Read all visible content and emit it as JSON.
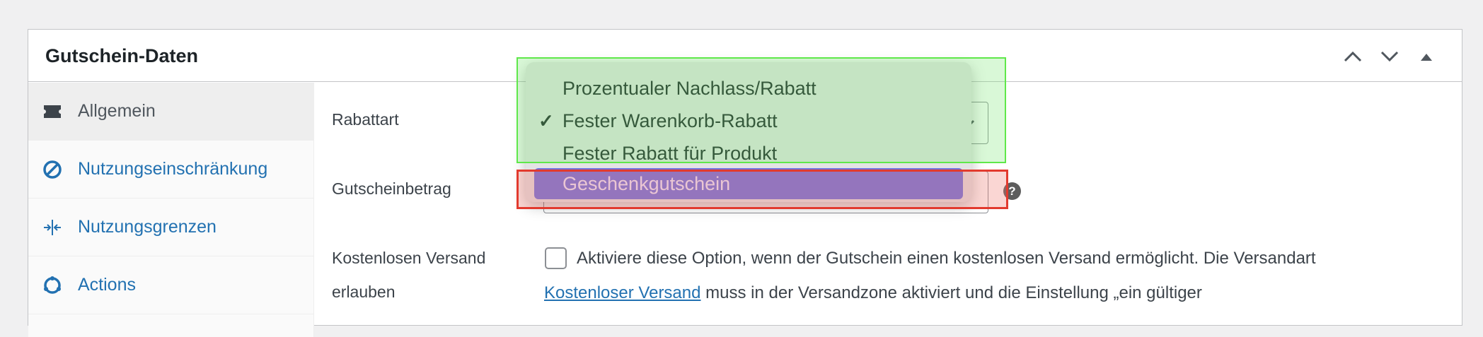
{
  "panel": {
    "title": "Gutschein-Daten"
  },
  "tabs": [
    {
      "label": "Allgemein",
      "icon": "ticket-icon"
    },
    {
      "label": "Nutzungseinschränkung",
      "icon": "no-entry-icon"
    },
    {
      "label": "Nutzungsgrenzen",
      "icon": "limits-icon"
    },
    {
      "label": "Actions",
      "icon": "cycle-icon"
    }
  ],
  "fields": {
    "rabattart_label": "Rabattart",
    "gutscheinbetrag_label": "Gutscheinbetrag",
    "versand_label_line1": "Kostenlosen Versand",
    "versand_label_line2": "erlauben",
    "help_glyph": "?",
    "versand_desc_line1": "Aktiviere diese Option, wenn der Gutschein einen kostenlosen Versand ermöglicht. Die Versandart",
    "versand_link": "Kostenloser Versand",
    "versand_desc_line2_rest": " muss in der Versandzone aktiviert und die Einstellung „ein gültiger"
  },
  "dropdown": {
    "options": [
      {
        "label": "Prozentualer Nachlass/Rabatt",
        "selected": false,
        "highlighted": false
      },
      {
        "label": "Fester Warenkorb-Rabatt",
        "selected": true,
        "highlighted": false
      },
      {
        "label": "Fester Rabatt für Produkt",
        "selected": false,
        "highlighted": false
      },
      {
        "label": "Geschenkgutschein",
        "selected": false,
        "highlighted": true
      }
    ],
    "check_glyph": "✓"
  },
  "colors": {
    "link": "#2271b1",
    "highlight": "#6e74e0",
    "annotation_green": "#5fe84a",
    "annotation_red": "#e23a2e"
  }
}
